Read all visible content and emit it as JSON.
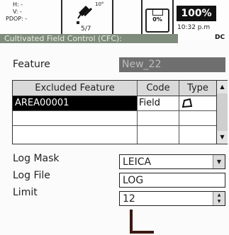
{
  "status": {
    "coord_h": "H: -",
    "coord_v": "V: -",
    "pdop": "PDOP: -",
    "sat_angle": "10°",
    "sat_count": "5/7",
    "disk_label": "0%",
    "battery": "100%",
    "clock": "10:32 p.m",
    "mode": "DC"
  },
  "title": "Cultivated Field Control (CFC):",
  "feature": {
    "label": "Feature",
    "value": "New_22"
  },
  "table": {
    "headers": [
      "Excluded Feature",
      "Code",
      "Type"
    ],
    "rows": [
      {
        "feature": "AREA00001",
        "code": "Field",
        "type_icon": "area-icon"
      }
    ]
  },
  "log_mask": {
    "label": "Log Mask",
    "value": "LEICA"
  },
  "log_file": {
    "label": "Log File",
    "value": "LOG"
  },
  "limit": {
    "label": "Limit",
    "value": "12"
  },
  "icons": {
    "satellite": "satellite-icon",
    "disk": "memory-card-icon",
    "battery": "battery-icon"
  }
}
